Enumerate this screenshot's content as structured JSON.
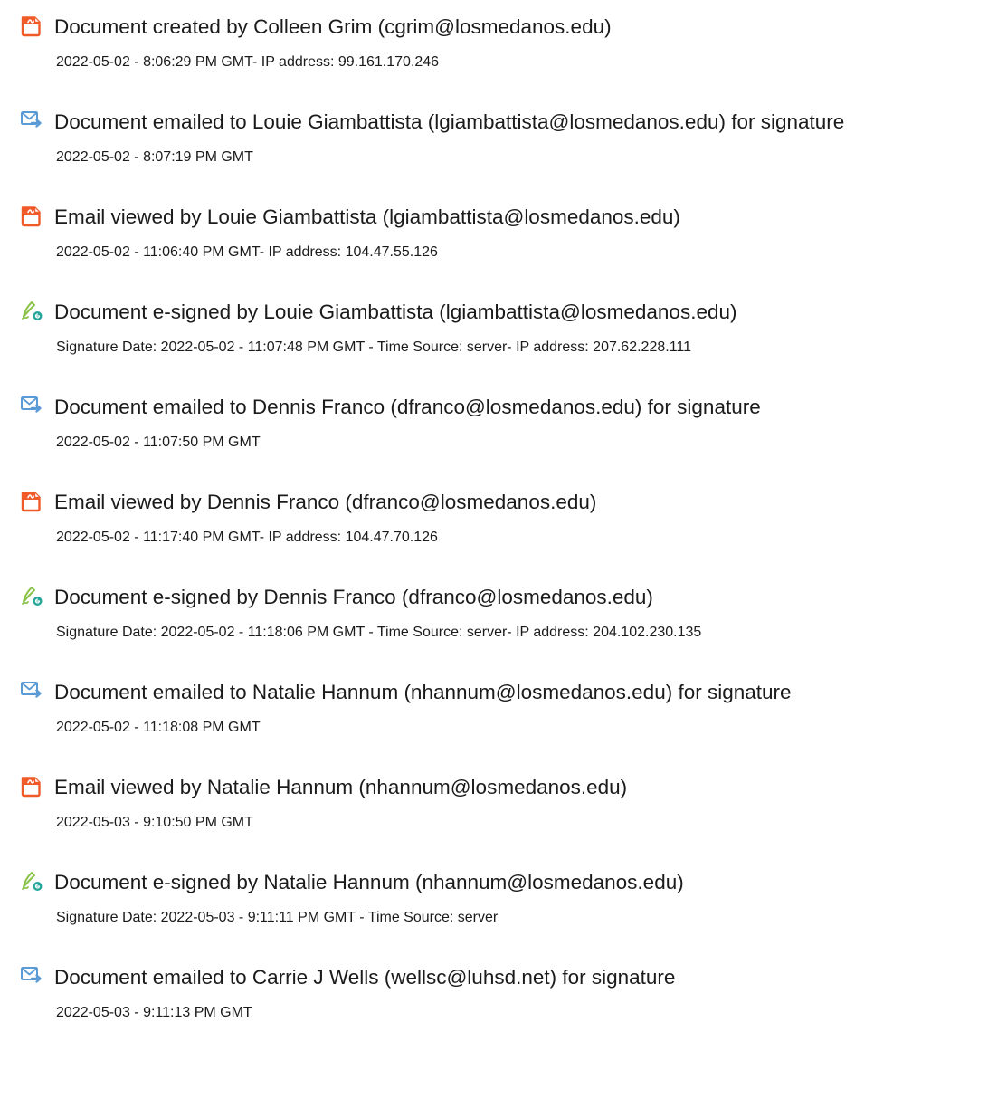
{
  "colors": {
    "document_icon": "#f05a28",
    "email_icon": "#5b9bd5",
    "sign_icon": "#8bc34a",
    "sign_dot": "#26a69a",
    "text": "#1b1b1b"
  },
  "entries": [
    {
      "icon": "document-icon",
      "title": "Document created by Colleen Grim (cgrim@losmedanos.edu)",
      "detail": "2022-05-02 - 8:06:29 PM GMT- IP address: 99.161.170.246"
    },
    {
      "icon": "email-sent-icon",
      "title": "Document emailed to Louie Giambattista (lgiambattista@losmedanos.edu) for signature",
      "detail": "2022-05-02 - 8:07:19 PM GMT"
    },
    {
      "icon": "document-icon",
      "title": "Email viewed by Louie Giambattista (lgiambattista@losmedanos.edu)",
      "detail": "2022-05-02 - 11:06:40 PM GMT- IP address: 104.47.55.126"
    },
    {
      "icon": "pen-signature-icon",
      "title": "Document e-signed by Louie Giambattista (lgiambattista@losmedanos.edu)",
      "detail": "Signature Date: 2022-05-02 - 11:07:48 PM GMT - Time Source: server- IP address: 207.62.228.111"
    },
    {
      "icon": "email-sent-icon",
      "title": "Document emailed to Dennis Franco (dfranco@losmedanos.edu) for signature",
      "detail": "2022-05-02 - 11:07:50 PM GMT"
    },
    {
      "icon": "document-icon",
      "title": "Email viewed by Dennis Franco (dfranco@losmedanos.edu)",
      "detail": "2022-05-02 - 11:17:40 PM GMT- IP address: 104.47.70.126"
    },
    {
      "icon": "pen-signature-icon",
      "title": "Document e-signed by Dennis Franco (dfranco@losmedanos.edu)",
      "detail": "Signature Date: 2022-05-02 - 11:18:06 PM GMT - Time Source: server- IP address: 204.102.230.135"
    },
    {
      "icon": "email-sent-icon",
      "title": "Document emailed to Natalie Hannum (nhannum@losmedanos.edu) for signature",
      "detail": "2022-05-02 - 11:18:08 PM GMT"
    },
    {
      "icon": "document-icon",
      "title": "Email viewed by Natalie Hannum (nhannum@losmedanos.edu)",
      "detail": "2022-05-03 - 9:10:50 PM GMT"
    },
    {
      "icon": "pen-signature-icon",
      "title": "Document e-signed by Natalie Hannum (nhannum@losmedanos.edu)",
      "detail": "Signature Date: 2022-05-03 - 9:11:11 PM GMT - Time Source: server"
    },
    {
      "icon": "email-sent-icon",
      "title": "Document emailed to Carrie J Wells (wellsc@luhsd.net) for signature",
      "detail": "2022-05-03 - 9:11:13 PM GMT"
    }
  ]
}
